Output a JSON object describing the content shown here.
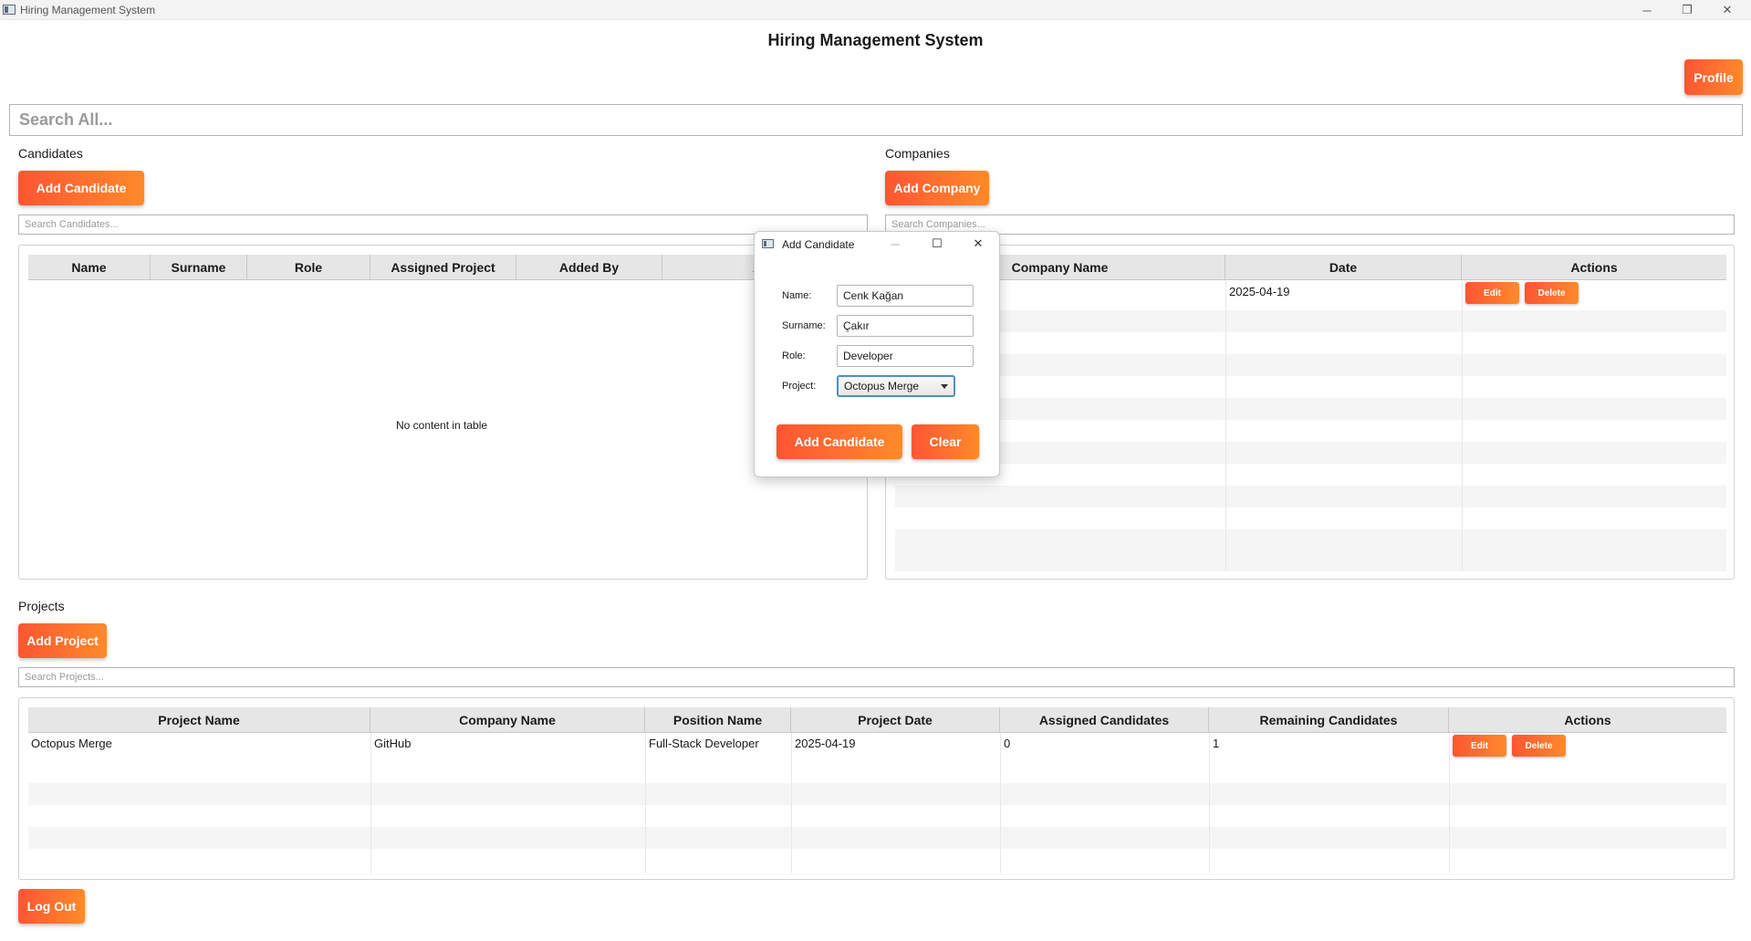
{
  "window": {
    "title": "Hiring Management System",
    "minimize_glyph": "─",
    "maximize_glyph": "❐",
    "close_glyph": "✕"
  },
  "header": {
    "title": "Hiring Management System",
    "profile_label": "Profile"
  },
  "search_all": {
    "placeholder": "Search All..."
  },
  "candidates": {
    "section_label": "Candidates",
    "add_label": "Add Candidate",
    "search_placeholder": "Search Candidates...",
    "columns": [
      "Name",
      "Surname",
      "Role",
      "Assigned Project",
      "Added By",
      "Ac"
    ],
    "empty_message": "No content in table"
  },
  "companies": {
    "section_label": "Companies",
    "add_label": "Add Company",
    "search_placeholder": "Search Companies...",
    "columns": [
      "Company Name",
      "Date",
      "Actions"
    ],
    "rows": [
      {
        "company_name": "",
        "date": "2025-04-19",
        "edit_label": "Edit",
        "delete_label": "Delete"
      }
    ]
  },
  "projects": {
    "section_label": "Projects",
    "add_label": "Add Project",
    "search_placeholder": "Search Projects...",
    "columns": [
      "Project Name",
      "Company Name",
      "Position Name",
      "Project Date",
      "Assigned Candidates",
      "Remaining Candidates",
      "Actions"
    ],
    "rows": [
      {
        "project_name": "Octopus Merge",
        "company_name": "GitHub",
        "position_name": "Full-Stack Developer",
        "project_date": "2025-04-19",
        "assigned": "0",
        "remaining": "1",
        "edit_label": "Edit",
        "delete_label": "Delete"
      }
    ]
  },
  "logout_label": "Log Out",
  "dialog": {
    "title": "Add Candidate",
    "minimize_glyph": "─",
    "maximize_glyph": "☐",
    "close_glyph": "✕",
    "name_label": "Name:",
    "name_value": "Cenk Kağan",
    "surname_label": "Surname:",
    "surname_value": "Çakır",
    "role_label": "Role:",
    "role_value": "Developer",
    "project_label": "Project:",
    "project_value": "Octopus Merge",
    "submit_label": "Add Candidate",
    "clear_label": "Clear"
  },
  "colors": {
    "accent_start": "#ff5533",
    "accent_end": "#ff8a2a",
    "focus": "#4a90c8"
  }
}
